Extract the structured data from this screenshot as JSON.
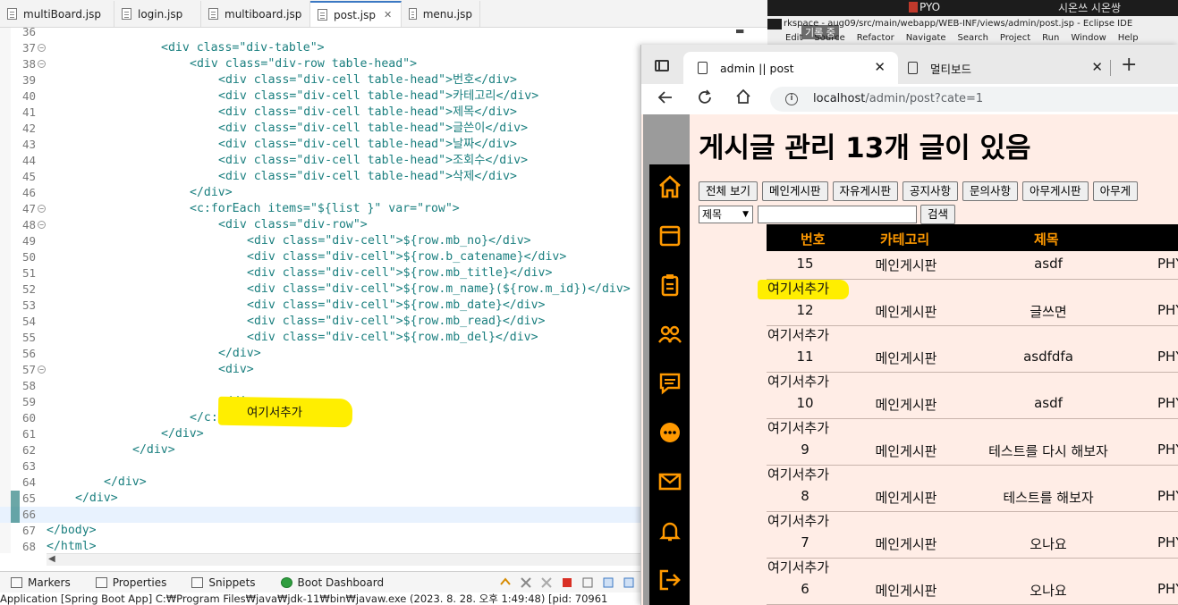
{
  "editor": {
    "tabs": [
      {
        "label": "multiBoard.jsp",
        "active": false
      },
      {
        "label": "login.jsp",
        "active": false
      },
      {
        "label": "multiboard.jsp",
        "active": false
      },
      {
        "label": "post.jsp",
        "active": true
      },
      {
        "label": "menu.jsp",
        "active": false
      }
    ],
    "lines": [
      {
        "n": "36",
        "text": ""
      },
      {
        "n": "37",
        "text": "<div class=\"div-table\">"
      },
      {
        "n": "38",
        "text": "<div class=\"div-row table-head\">"
      },
      {
        "n": "39",
        "text": "<div class=\"div-cell table-head\">번호</div>"
      },
      {
        "n": "40",
        "text": "<div class=\"div-cell table-head\">카테고리</div>"
      },
      {
        "n": "41",
        "text": "<div class=\"div-cell table-head\">제목</div>"
      },
      {
        "n": "42",
        "text": "<div class=\"div-cell table-head\">글쓴이</div>"
      },
      {
        "n": "43",
        "text": "<div class=\"div-cell table-head\">날짜</div>"
      },
      {
        "n": "44",
        "text": "<div class=\"div-cell table-head\">조회수</div>"
      },
      {
        "n": "45",
        "text": "<div class=\"div-cell table-head\">삭제</div>"
      },
      {
        "n": "46",
        "text": "</div>"
      },
      {
        "n": "47",
        "text": "<c:forEach items=\"${list }\" var=\"row\">"
      },
      {
        "n": "48",
        "text": "<div class=\"div-row\">"
      },
      {
        "n": "49",
        "text": "<div class=\"div-cell\">${row.mb_no}</div>"
      },
      {
        "n": "50",
        "text": "<div class=\"div-cell\">${row.b_catename}</div>"
      },
      {
        "n": "51",
        "text": "<div class=\"div-cell\">${row.mb_title}</div>"
      },
      {
        "n": "52",
        "text": "<div class=\"div-cell\">${row.m_name}(${row.m_id})</div>"
      },
      {
        "n": "53",
        "text": "<div class=\"div-cell\">${row.mb_date}</div>"
      },
      {
        "n": "54",
        "text": "<div class=\"div-cell\">${row.mb_read}</div>"
      },
      {
        "n": "55",
        "text": "<div class=\"div-cell\">${row.mb_del}</div>"
      },
      {
        "n": "56",
        "text": "</div>"
      },
      {
        "n": "57",
        "text": "<div>"
      },
      {
        "n": "58",
        "text": "여기서추가"
      },
      {
        "n": "59",
        "text": "</div>"
      },
      {
        "n": "60",
        "text": "</c:forEach>"
      },
      {
        "n": "61",
        "text": "</div>"
      },
      {
        "n": "62",
        "text": "</div>"
      },
      {
        "n": "63",
        "text": ""
      },
      {
        "n": "64",
        "text": "</div>"
      },
      {
        "n": "65",
        "text": "</div>"
      },
      {
        "n": "66",
        "text": ""
      },
      {
        "n": "67",
        "text": "</body>"
      },
      {
        "n": "68",
        "text": "</html>"
      }
    ],
    "bottom_tabs": [
      "Markers",
      "Properties",
      "Snippets",
      "Boot Dashboard"
    ],
    "status": "Application [Spring Boot App] C:₩Program Files₩java₩jdk-11₩bin₩javaw.exe  (2023. 8. 28. 오후 1:49:48) [pid: 70961"
  },
  "background_window": {
    "taskbar_user": "PYO",
    "taskbar_text": "시온쓰 시온쌍",
    "title": "rkspace - aug09/src/main/webapp/WEB-INF/views/admin/post.jsp - Eclipse IDE",
    "overlay_text": "기록 중",
    "menu": [
      "Edit",
      "Source",
      "Refactor",
      "Navigate",
      "Search",
      "Project",
      "Run",
      "Window",
      "Help"
    ]
  },
  "browser": {
    "tabs": [
      {
        "label": "admin || post",
        "active": true
      },
      {
        "label": "멀티보드",
        "active": false
      }
    ],
    "url_host": "localhost",
    "url_path": "/admin/post?cate=1",
    "page_title": "게시글 관리 13개 글이 있음",
    "category_buttons": [
      "전체 보기",
      "메인게시판",
      "자유게시판",
      "공지사항",
      "문의사항",
      "아무게시판",
      "아무게"
    ],
    "search_select": "제목",
    "search_input": "",
    "search_button": "검색",
    "table_headers": [
      "번호",
      "카테고리",
      "제목"
    ],
    "rows": [
      {
        "no": "15",
        "category": "메인게시판",
        "title": "asdf",
        "name": "PHY",
        "note": "여기서추가"
      },
      {
        "no": "12",
        "category": "메인게시판",
        "title": "글쓰면",
        "name": "PHY",
        "note": "여기서추가"
      },
      {
        "no": "11",
        "category": "메인게시판",
        "title": "asdfdfa",
        "name": "PHY",
        "note": "여기서추가"
      },
      {
        "no": "10",
        "category": "메인게시판",
        "title": "asdf",
        "name": "PHY",
        "note": "여기서추가"
      },
      {
        "no": "9",
        "category": "메인게시판",
        "title": "테스트를 다시 해보자",
        "name": "PHY",
        "note": "여기서추가"
      },
      {
        "no": "8",
        "category": "메인게시판",
        "title": "테스트를 해보자",
        "name": "PHY",
        "note": "여기서추가"
      },
      {
        "no": "7",
        "category": "메인게시판",
        "title": "오나요",
        "name": "PHY",
        "note": "여기서추가"
      },
      {
        "no": "6",
        "category": "메인게시판",
        "title": "오나요",
        "name": "PHY",
        "note": ""
      }
    ],
    "sidebar_icons": [
      "home-icon",
      "board-icon",
      "clipboard-icon",
      "users-icon",
      "comment-icon",
      "chat-icon",
      "mail-icon",
      "bell-icon",
      "logout-icon"
    ]
  },
  "colors": {
    "sidebar_icon": "#ff9900",
    "table_head_bg": "#000000",
    "table_head_text": "#ff9900",
    "page_bg": "#ffede6",
    "highlight": "#ffee00"
  }
}
